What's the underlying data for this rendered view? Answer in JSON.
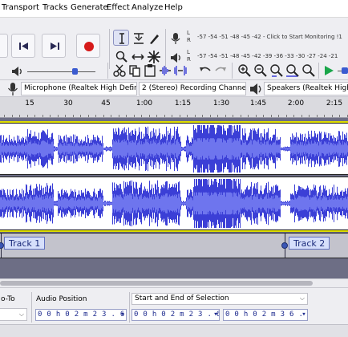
{
  "menubar": {
    "items": [
      "Transport",
      "Tracks",
      "Generate",
      "Effect",
      "Analyze",
      "Help"
    ]
  },
  "toolbar": {
    "transport_buttons": [
      "skip-to-start-icon",
      "skip-to-end-icon",
      "record-icon"
    ],
    "tool_icons": [
      "selection-tool-icon",
      "envelope-tool-icon",
      "draw-tool-icon",
      "zoom-tool-icon",
      "timeshift-tool-icon",
      "multi-tool-icon"
    ],
    "edit_icons": [
      "cut-icon",
      "copy-icon",
      "paste-icon",
      "trim-icon",
      "silence-icon",
      "undo-icon",
      "redo-icon",
      "zoom-in-icon",
      "zoom-out-icon",
      "fit-selection-icon",
      "fit-project-icon",
      "zoom-toggle-icon",
      "play-at-speed-icon"
    ],
    "record_meter": {
      "l_label": "L",
      "r_label": "R",
      "scale": "-57 -54 -51 -48 -45 -42 -",
      "hint": "Click to Start Monitoring !1"
    },
    "play_meter": {
      "l_label": "L",
      "r_label": "R",
      "scale": "-57 -54 -51 -48 -45 -42 -39 -36 -33 -30 -27 -24 -21"
    }
  },
  "devicebar": {
    "mic_device": "Microphone (Realtek High Defini",
    "channels": "2 (Stereo) Recording Channels",
    "playback_device": "Speakers (Realtek High Defi"
  },
  "ruler": {
    "ticks": [
      "15",
      "30",
      "45",
      "1:00",
      "1:15",
      "1:30",
      "1:45",
      "2:00",
      "2:15"
    ]
  },
  "label_track": {
    "labels": [
      "Track 1",
      "Track 2"
    ]
  },
  "selection_bar": {
    "snap_label": "o-To",
    "audio_position_label": "Audio Position",
    "audio_position": "0 0 h 0 2 m 2 3 . 6 5 3 s",
    "selection_label": "Start and End of Selection",
    "selection_start": "0 0 h 0 2 m 2 3 . 6 5 3 s",
    "selection_end": "0 0 h 0 2 m 3 6 . 7 7 6 s"
  },
  "colors": {
    "waveform": "#3b3fd6",
    "waveform_rms": "#6e75ee",
    "selection_line": "#e0e000",
    "track_bg": "#6d6e85",
    "record_red": "#d61b1b"
  }
}
